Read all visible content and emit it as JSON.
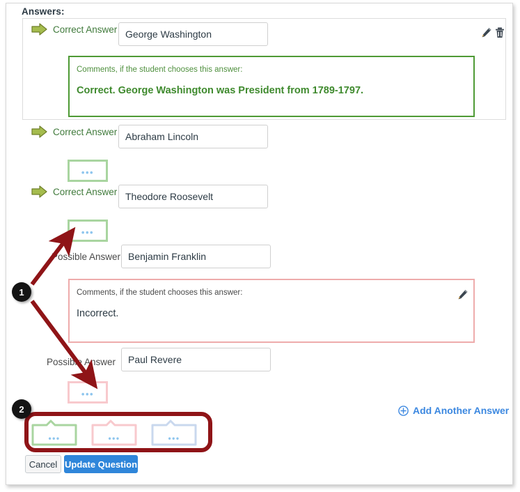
{
  "heading": "Answers:",
  "colors": {
    "correct_green": "#407a3b",
    "comment_green_border": "#4e9a35",
    "comment_pink_border": "#eeabab",
    "collapsed_green_border": "#a9d5a0",
    "collapsed_pink_border": "#f8c9cd",
    "collapsed_blue_border": "#c9d8ee",
    "dots_blue": "#8fc6ee",
    "link_blue": "#3c88e0",
    "button_blue": "#2f86da",
    "annotation_red": "#8f1417",
    "badge_black": "#141414"
  },
  "answers": [
    {
      "label": "Correct Answer",
      "type": "correct",
      "value": "George Washington",
      "comment": {
        "state": "expanded",
        "tone": "green",
        "label": "Comments, if the student chooses this answer:",
        "body": "Correct. George Washington was President from 1789-1797."
      }
    },
    {
      "label": "Correct Answer",
      "type": "correct",
      "value": "Abraham Lincoln",
      "comment": {
        "state": "collapsed",
        "tone": "green",
        "dots": "•••"
      }
    },
    {
      "label": "Correct Answer",
      "type": "correct",
      "value": "Theodore Roosevelt",
      "comment": {
        "state": "collapsed",
        "tone": "green",
        "dots": "•••"
      }
    },
    {
      "label": "Possible Answer",
      "type": "possible",
      "value": "Benjamin Franklin",
      "comment": {
        "state": "expanded",
        "tone": "pink",
        "label": "Comments, if the student chooses this answer:",
        "body": "Incorrect."
      }
    },
    {
      "label": "Possible Answer",
      "type": "possible",
      "value": "Paul Revere",
      "comment": {
        "state": "collapsed",
        "tone": "pink",
        "dots": "•••"
      }
    }
  ],
  "row_icons": {
    "edit": "pencil-icon",
    "delete": "trash-icon",
    "comment_edit": "pencil-icon"
  },
  "add_answer": {
    "icon": "plus-circle-icon",
    "label": "Add Another Answer"
  },
  "legend_bubbles": [
    {
      "tone": "green",
      "dots": "•••"
    },
    {
      "tone": "pink",
      "dots": "•••"
    },
    {
      "tone": "blue",
      "dots": "•••"
    }
  ],
  "buttons": {
    "cancel": "Cancel",
    "update": "Update Question"
  },
  "annotations": [
    {
      "id": "1",
      "label": "1"
    },
    {
      "id": "2",
      "label": "2"
    }
  ]
}
